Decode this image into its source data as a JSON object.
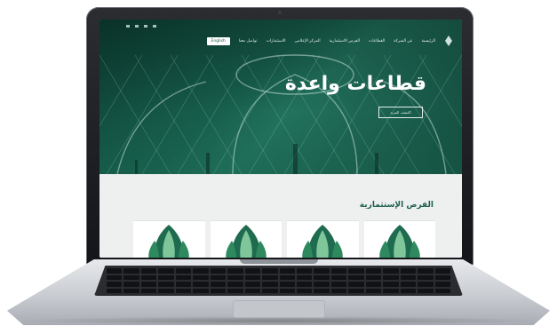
{
  "hero": {
    "title": "قطاعات واعدة",
    "cta": "اكتشف المزيد"
  },
  "nav": {
    "items": [
      "الرئيسية",
      "عن الشركة",
      "القطاعات",
      "الفرص الاستثمارية",
      "المركز الإعلامي",
      "الاستثمارات",
      "تواصل معنا"
    ],
    "cta": "English"
  },
  "section": {
    "title": "الفرص الإستثمارية",
    "subtitle": ""
  },
  "colors": {
    "brand_dark": "#1c5f4c",
    "brand_green": "#2f8a72",
    "leaf_light": "#7fc79b"
  },
  "icons": [
    "leaf-emblem-icon",
    "camera-icon"
  ]
}
